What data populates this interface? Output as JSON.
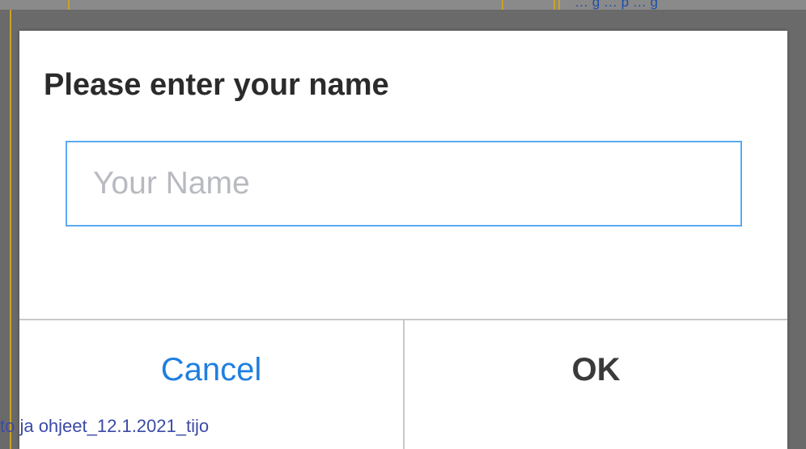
{
  "background": {
    "link_text": "… g … p … g",
    "caption": "to ja ohjeet_12.1.2021_tijo"
  },
  "dialog": {
    "title": "Please enter your name",
    "input": {
      "value": "",
      "placeholder": "Your Name"
    },
    "cancel_label": "Cancel",
    "ok_label": "OK"
  },
  "colors": {
    "accent": "#1f7fe0",
    "input_border": "#5aaaf0",
    "overlay": "#6a6a6a"
  }
}
